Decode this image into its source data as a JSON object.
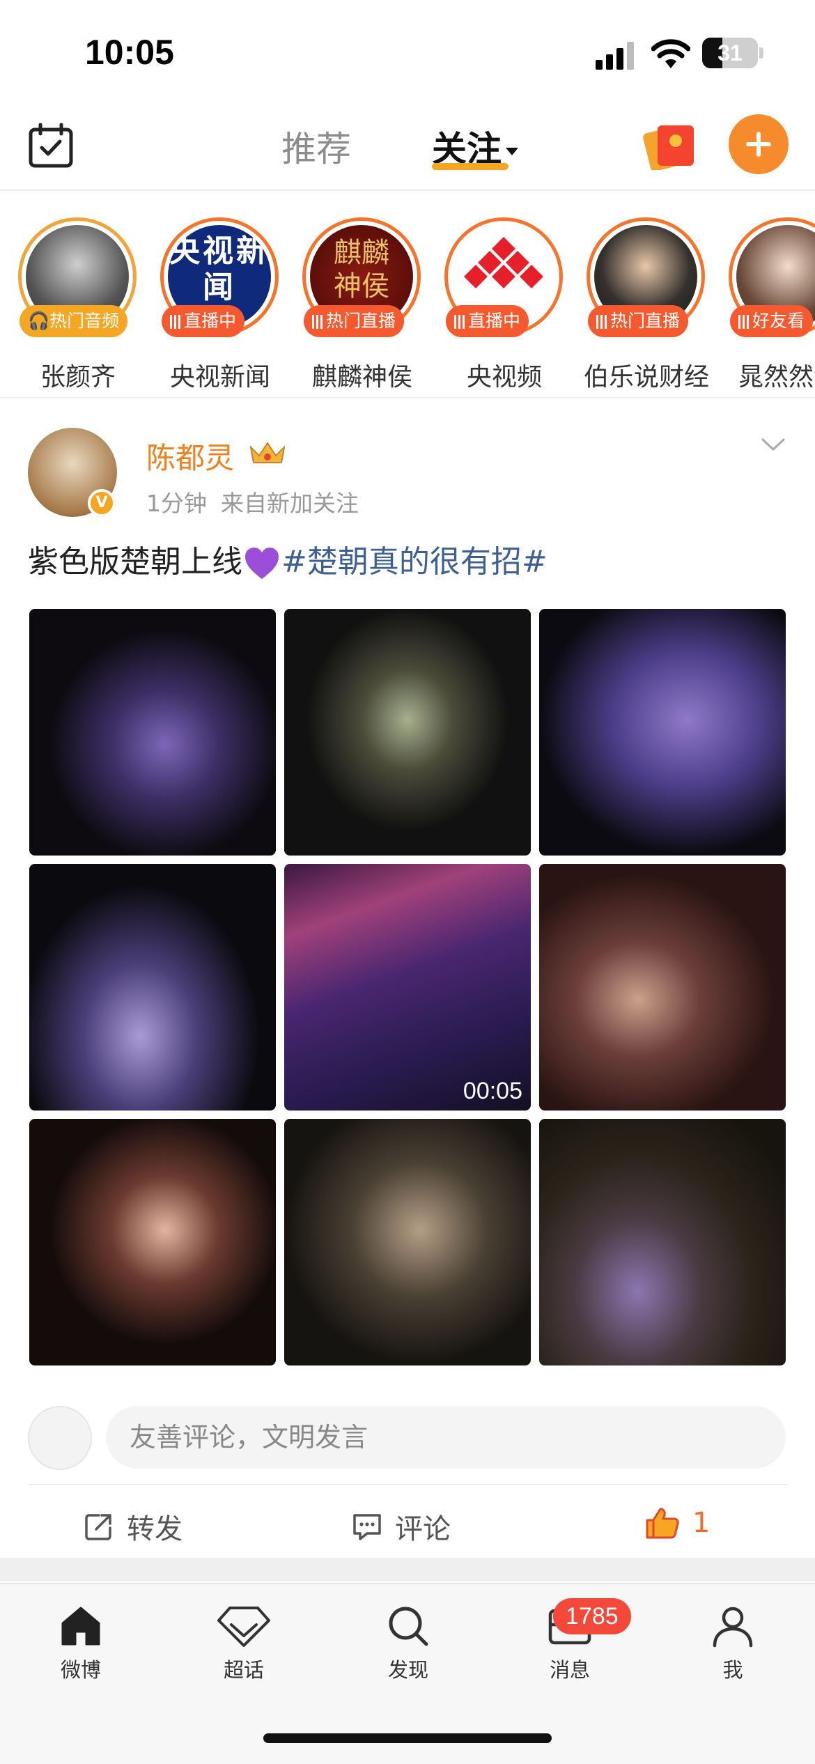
{
  "status_bar": {
    "time": "10:05",
    "battery": "31"
  },
  "top_nav": {
    "tabs": [
      {
        "label": "推荐",
        "active": false
      },
      {
        "label": "关注",
        "active": true
      }
    ],
    "accent_color": "#f58b2c"
  },
  "stories": [
    {
      "name": "张颜齐",
      "badge": "热门音频",
      "badge_style": "orange",
      "icon": "headphones-icon"
    },
    {
      "name": "央视新闻",
      "badge": "直播中",
      "badge_style": "red",
      "logo_text": "央视新闻"
    },
    {
      "name": "麒麟神侯",
      "badge": "热门直播",
      "badge_style": "red",
      "logo_text": "麒麟神侯"
    },
    {
      "name": "央视频",
      "badge": "直播中",
      "badge_style": "red"
    },
    {
      "name": "伯乐说财经",
      "badge": "热门直播",
      "badge_style": "red"
    },
    {
      "name": "晁然然然",
      "badge": "好友看",
      "badge_style": "red"
    }
  ],
  "post": {
    "author": "陈都灵",
    "time": "1分钟",
    "source": "来自新加关注",
    "text": "紫色版楚朝上线",
    "hashtag": "#楚朝真的很有招#",
    "video_duration": "00:05",
    "comment_placeholder": "友善评论，文明发言",
    "actions": {
      "repost": "转发",
      "comment": "评论",
      "like_count": "1"
    }
  },
  "tab_bar": {
    "items": [
      {
        "label": "微博",
        "icon": "home-icon"
      },
      {
        "label": "超话",
        "icon": "diamond-icon"
      },
      {
        "label": "发现",
        "icon": "search-icon"
      },
      {
        "label": "消息",
        "icon": "message-icon"
      },
      {
        "label": "我",
        "icon": "person-icon"
      }
    ],
    "message_badge": "1785"
  }
}
